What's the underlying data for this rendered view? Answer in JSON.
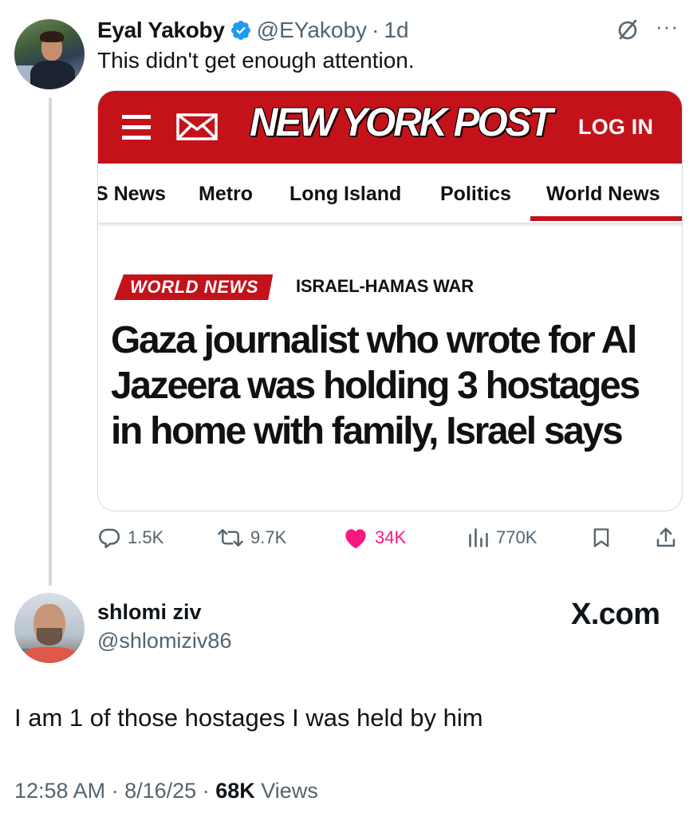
{
  "tweet": {
    "author_name": "Eyal Yakoby",
    "author_handle": "@EYakoby",
    "dot": "·",
    "age": "1d",
    "text": "This didn't get enough attention.",
    "more": "···"
  },
  "card": {
    "logo": "NEW YORK POST",
    "login": "LOG IN",
    "nav": [
      "S News",
      "Metro",
      "Long Island",
      "Politics",
      "World News"
    ],
    "badge": "WORLD NEWS",
    "kicker": "ISRAEL-HAMAS WAR",
    "headline": "Gaza journalist who wrote for Al Jazeera was holding 3 hostages in home with family, Israel says"
  },
  "actions": {
    "replies": "1.5K",
    "reposts": "9.7K",
    "likes": "34K",
    "views": "770K"
  },
  "reply": {
    "author_name": "shlomi ziv",
    "author_handle": "@shlomiziv86",
    "site": "X.com",
    "text": "I am 1 of those hostages I was held by him",
    "time": "12:58 AM",
    "sep": "·",
    "date": "8/16/25",
    "views_count": "68K",
    "views_label": "Views"
  },
  "colors": {
    "nyp_red": "#c4121b",
    "verified_blue": "#1d9bf0",
    "like_pink": "#f91880",
    "muted_text": "#536471"
  },
  "icons": [
    "grok-icon",
    "more-icon",
    "verified-badge-icon",
    "hamburger-icon",
    "mail-icon",
    "reply-icon",
    "repost-icon",
    "heart-icon",
    "views-icon",
    "bookmark-icon",
    "share-icon"
  ]
}
